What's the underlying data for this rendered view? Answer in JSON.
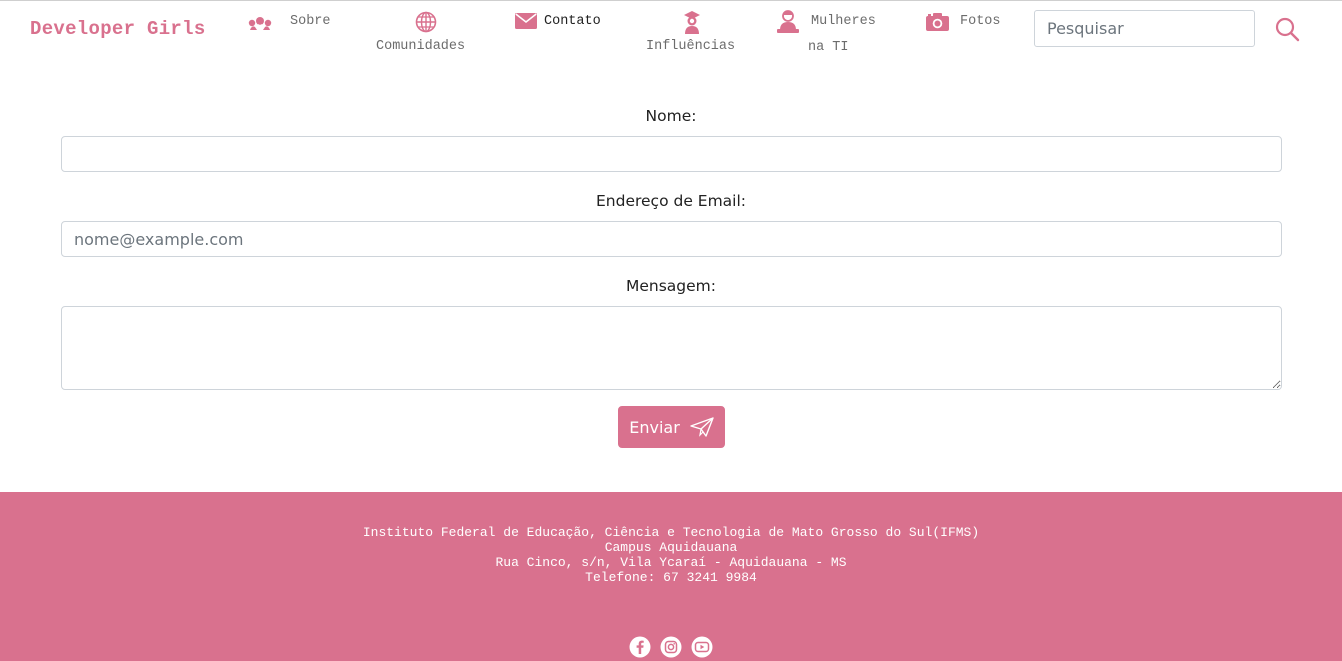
{
  "brand": "Developer Girls",
  "nav": {
    "sobre": "Sobre",
    "comunidades": "Comunidades",
    "contato": "Contato",
    "influencias": "Influências",
    "mulheres_line1": "Mulheres",
    "mulheres_line2": "na TI",
    "fotos": "Fotos"
  },
  "search": {
    "placeholder": "Pesquisar"
  },
  "form": {
    "name_label": "Nome:",
    "email_label": "Endereço de Email:",
    "email_placeholder": "nome@example.com",
    "message_label": "Mensagem:",
    "submit_label": "Enviar"
  },
  "footer": {
    "line1": "Instituto Federal de Educação, Ciência e Tecnologia de Mato Grosso do Sul(IFMS)",
    "line2": "Campus Aquidauana",
    "line3": "Rua Cinco, s/n, Vila Ycaraí - Aquidauana - MS",
    "line4": "Telefone: 67 3241 9984"
  },
  "icons": {
    "sobre": "group-hearts-icon",
    "comunidades": "globe-icon",
    "contato": "envelope-icon",
    "influencias": "graduate-woman-icon",
    "mulheres": "woman-at-computer-icon",
    "fotos": "camera-icon",
    "search": "search-icon",
    "submit": "paper-plane-icon",
    "social": [
      "facebook-icon",
      "instagram-icon",
      "youtube-icon"
    ]
  },
  "colors": {
    "brand": "#d9718e",
    "footer_bg": "#d9718e",
    "nav_text": "#6c6c6c",
    "nav_active_text": "#222222"
  }
}
